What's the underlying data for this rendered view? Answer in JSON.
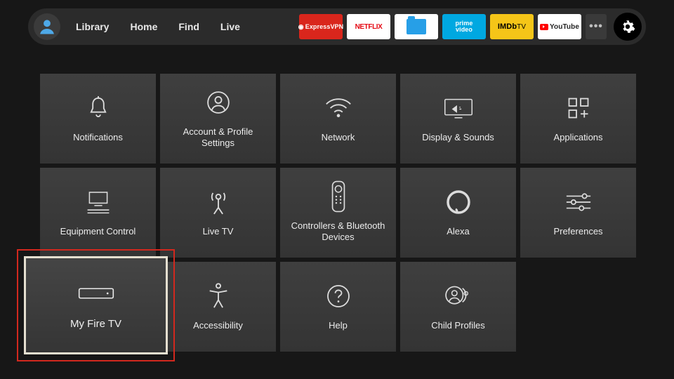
{
  "nav": {
    "library": "Library",
    "home": "Home",
    "find": "Find",
    "live": "Live"
  },
  "apps": {
    "expressvpn": "ExpressVPN",
    "netflix": "NETFLIX",
    "prime_l1": "prime",
    "prime_l2": "video",
    "imdb": "IMDb",
    "imdb_suffix": "TV",
    "youtube": "YouTube",
    "overflow": "•••"
  },
  "tiles": {
    "notifications": "Notifications",
    "account": "Account & Profile Settings",
    "network": "Network",
    "display": "Display & Sounds",
    "applications": "Applications",
    "equipment": "Equipment Control",
    "livetv": "Live TV",
    "controllers": "Controllers & Bluetooth Devices",
    "alexa": "Alexa",
    "preferences": "Preferences",
    "myfiretv": "My Fire TV",
    "accessibility": "Accessibility",
    "help": "Help",
    "childprofiles": "Child Profiles"
  }
}
